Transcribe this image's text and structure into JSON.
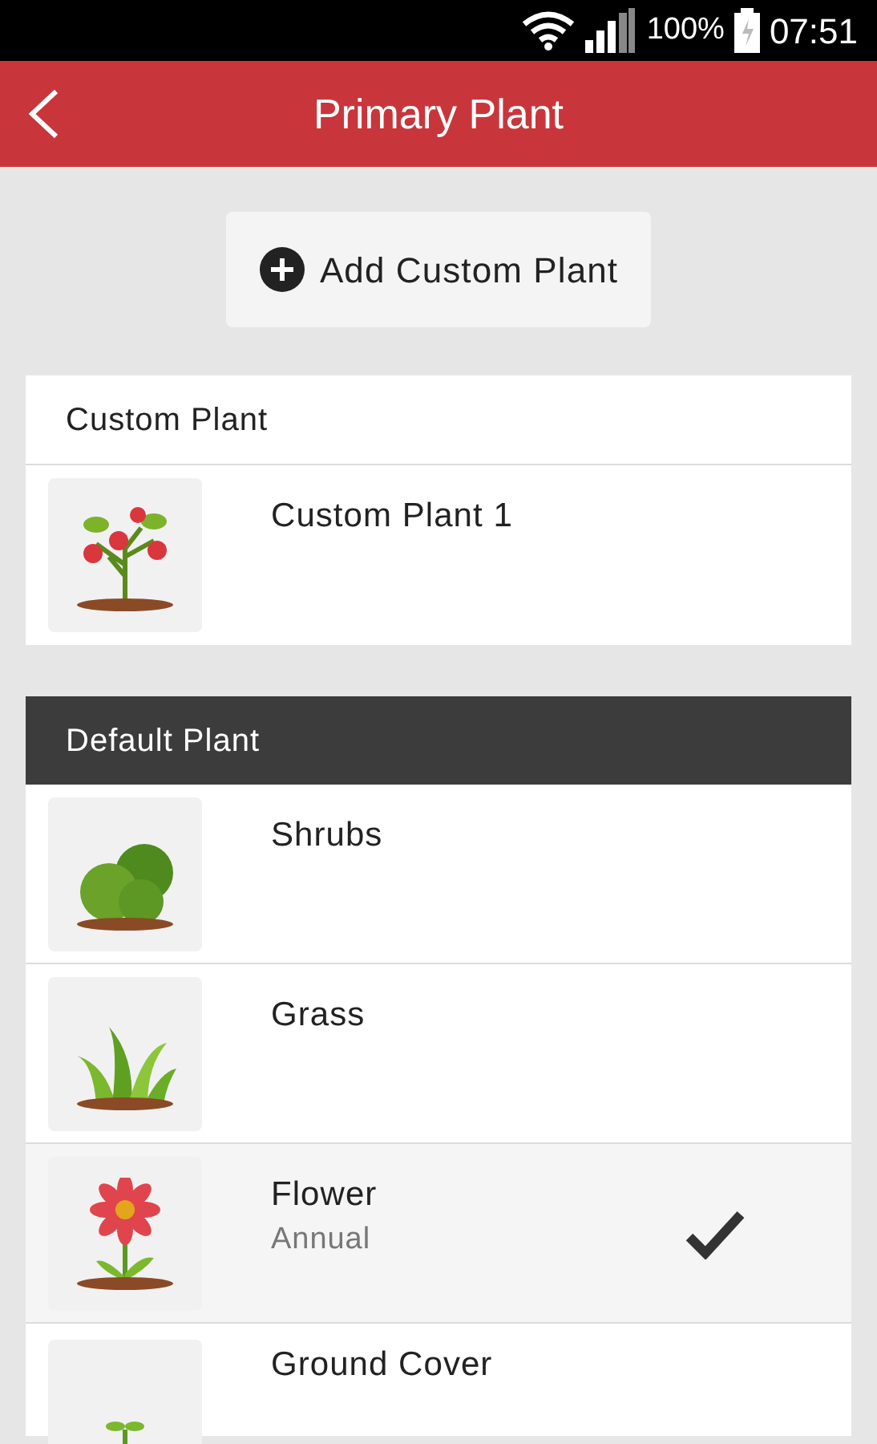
{
  "status_bar": {
    "battery": "100%",
    "time": "07:51"
  },
  "app_bar": {
    "title": "Primary Plant"
  },
  "add_button": {
    "label": "Add Custom Plant"
  },
  "custom_section": {
    "title": "Custom Plant",
    "items": [
      {
        "kind": "tomato",
        "name": "Custom Plant 1",
        "selected": false
      }
    ]
  },
  "default_section": {
    "title": "Default Plant",
    "items": [
      {
        "kind": "shrub",
        "name": "Shrubs",
        "selected": false
      },
      {
        "kind": "grass",
        "name": "Grass",
        "selected": false
      },
      {
        "kind": "flower",
        "name": "Flower",
        "subtitle": "Annual",
        "selected": true
      },
      {
        "kind": "sprout",
        "name": "Ground Cover",
        "selected": false
      }
    ]
  }
}
